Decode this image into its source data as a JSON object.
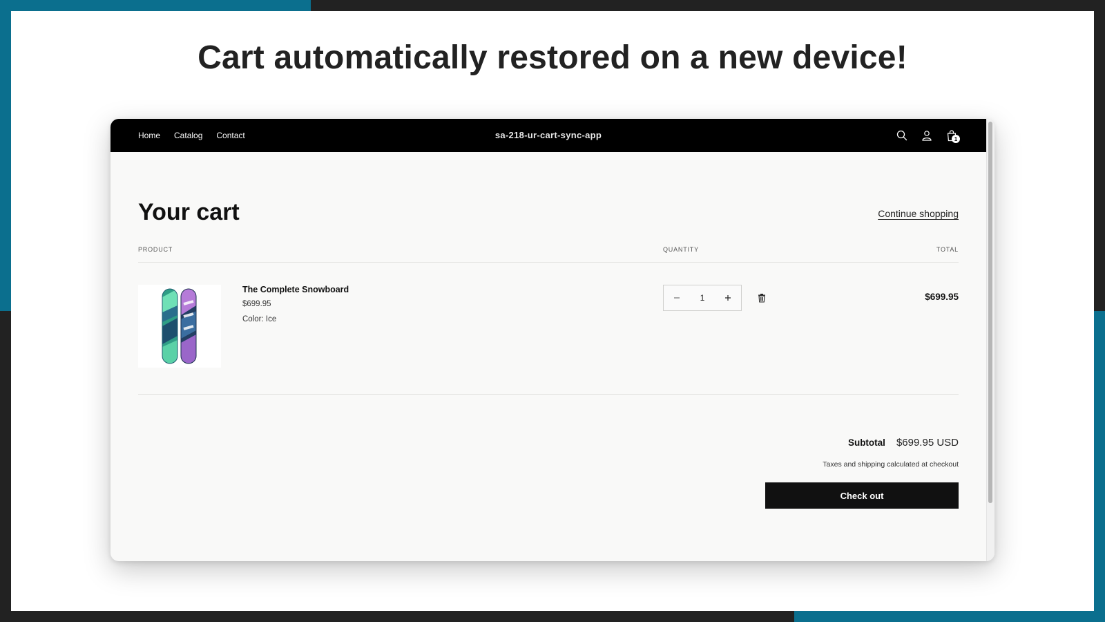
{
  "slide": {
    "headline": "Cart automatically restored on a new device!",
    "colors": {
      "accent": "#0b6f8e",
      "background": "#222222"
    }
  },
  "store": {
    "name": "sa-218-ur-cart-sync-app",
    "nav": [
      "Home",
      "Catalog",
      "Contact"
    ],
    "icons": [
      "search-icon",
      "account-icon",
      "cart-icon"
    ],
    "cart_count": "1"
  },
  "cart": {
    "title": "Your cart",
    "continue_label": "Continue shopping",
    "columns": {
      "product": "PRODUCT",
      "quantity": "QUANTITY",
      "total": "TOTAL"
    },
    "items": [
      {
        "name": "The Complete Snowboard",
        "price": "$699.95",
        "variant": "Color: Ice",
        "quantity": "1",
        "line_total": "$699.95",
        "image_icon": "snowboard-image"
      }
    ],
    "subtotal_label": "Subtotal",
    "subtotal_value": "$699.95 USD",
    "tax_note": "Taxes and shipping calculated at checkout",
    "checkout_label": "Check out"
  }
}
